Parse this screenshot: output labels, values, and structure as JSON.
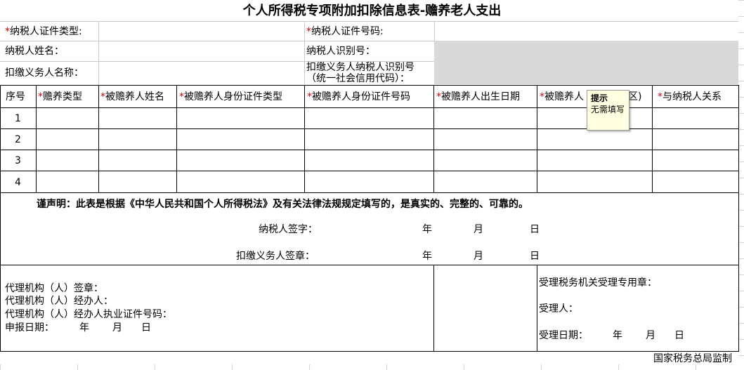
{
  "form": {
    "title": "个人所得税专项附加扣除信息表-赡养老人支出",
    "taxpayer_id_type_label": "纳税人证件类型:",
    "taxpayer_id_number_label": "纳税人证件号码:",
    "taxpayer_name_label": "纳税人姓名：",
    "taxpayer_tax_id_label": "纳税人识别号：",
    "withholder_name_label": "扣缴义务人名称：",
    "withholder_tax_id_label_line1": "扣缴义务人纳税人识别号",
    "withholder_tax_id_label_line2": "（统一社会信用代码）：",
    "required_mark": "*"
  },
  "table": {
    "columns": [
      {
        "label": "序号",
        "required": false
      },
      {
        "label": "赡养类型",
        "required": true
      },
      {
        "label": "被赡养人姓名",
        "required": true
      },
      {
        "label": "被赡养人身份证件类型",
        "required": true
      },
      {
        "label": "被赡养人身份证件号码",
        "required": true
      },
      {
        "label": "被赡养人出生日期",
        "required": true
      },
      {
        "label": "被赡养人",
        "required": true
      },
      {
        "label": "与纳税人关系",
        "required": true
      }
    ],
    "col7_tail": "区)",
    "rows": [
      "1",
      "2",
      "3",
      "4"
    ]
  },
  "declaration": {
    "statement": "谨声明：此表是根据《中华人民共和国个人所得税法》及有关法律法规规定填写的，是真实的、完整的、可靠的。",
    "taxpayer_sign_label": "纳税人签字：",
    "withholder_sign_label": "扣缴义务人签章：",
    "year": "年",
    "month": "月",
    "day": "日"
  },
  "agent": {
    "line1": "代理机构（人）签章：",
    "line2": "代理机构（人）经办人：",
    "line3": "代理机构（人）经办人执业证件号码：",
    "date_label": "申报日期：",
    "year": "年",
    "month": "月",
    "day": "日"
  },
  "acceptance": {
    "seal_label": "受理税务机关受理专用章：",
    "handler_label": "受理人：",
    "date_label": "受理日期：",
    "year": "年",
    "month": "月",
    "day": "日"
  },
  "footer": {
    "supervisor": "国家税务总局监制"
  },
  "tooltip": {
    "title": "提示",
    "body": "无需填写"
  },
  "colors": {
    "required_mark": "#d00000",
    "shaded_cell": "#d9d9d9",
    "tooltip_bg": "#ffffe1"
  }
}
